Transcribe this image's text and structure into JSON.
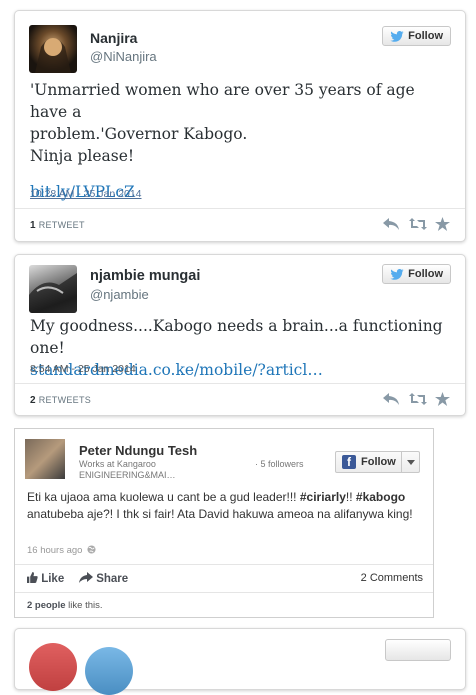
{
  "tweet1": {
    "name": "Nanjira",
    "handle": "@NiNanjira",
    "follow_label": "Follow",
    "text_line1": "'Unmarried women who are over 35 years of age have a",
    "text_line2": "problem.'Governor Kabogo.",
    "text_line3": "Ninja please!",
    "link": "bit.ly/LVPLcZ",
    "timestamp": "10:28 AM - 25 Jan 2014",
    "retweet_count": "1",
    "retweet_label": "RETWEET"
  },
  "tweet2": {
    "name": "njambie mungai",
    "handle": "@njambie",
    "follow_label": "Follow",
    "text": "My goodness....Kabogo needs a brain...a functioning one!",
    "link": "standardmedia.co.ke/mobile/?articl…",
    "timestamp": "8:54 AM - 25 Jan 2014",
    "retweet_count": "2",
    "retweet_label": "RETWEETS"
  },
  "fbpost": {
    "name": "Peter Ndungu Tesh",
    "subtitle": "Works at Kangaroo ENIGINEERING&MAI… · 5 followers",
    "subtitle_a": "Works at Kangaroo ENIGINEERING&MAI…",
    "subtitle_b": "· 5 followers",
    "follow_label": "Follow",
    "text_part1": "Eti ka ujaoa ama kuolewa u cant be a gud leader!!! ",
    "hashtag1": "#ciriarly",
    "text_part2": "!! ",
    "hashtag2": "#kabogo",
    "text_part3": " anatubeba aje?! I thk si fair! Ata David hakuwa ameoa na alifanywa king!",
    "time": "16 hours ago",
    "like_label": "Like",
    "share_label": "Share",
    "comments": "2 Comments",
    "people_count": "2 people",
    "people_suffix": " like this."
  },
  "colors": {
    "twitter_blue": "#55acee",
    "link_blue": "#1f76b8",
    "facebook_blue": "#3b5998"
  },
  "icons": [
    "twitter-bird-icon",
    "reply-icon",
    "retweet-icon",
    "favorite-icon",
    "facebook-icon",
    "globe-icon",
    "like-icon",
    "share-icon",
    "chevron-down-icon"
  ]
}
